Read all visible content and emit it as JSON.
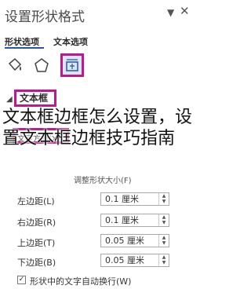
{
  "pane": {
    "title": "设置形状格式"
  },
  "tabs": [
    {
      "label": "形状选项"
    },
    {
      "label": "文本选项"
    }
  ],
  "section": {
    "title": "文本框"
  },
  "fields": {
    "text_direction_label": "文字方向(X)",
    "autofit_label": "调整形状大小(F)",
    "rows": [
      {
        "label": "左边距(L)",
        "value": "0.1 厘米"
      },
      {
        "label": "右边距(R)",
        "value": "0.1 厘米"
      },
      {
        "label": "上边距(T)",
        "value": "0.05 厘米"
      },
      {
        "label": "下边距(B)",
        "value": "0.05 厘米"
      }
    ],
    "wrap_checkbox_label": "形状中的文字自动换行(W)"
  },
  "overlay_text": "文本框边框怎么设置，设置文本框边框技巧指南",
  "colors": {
    "highlight": "#c0178a",
    "tab_underline": "#2b579a"
  }
}
